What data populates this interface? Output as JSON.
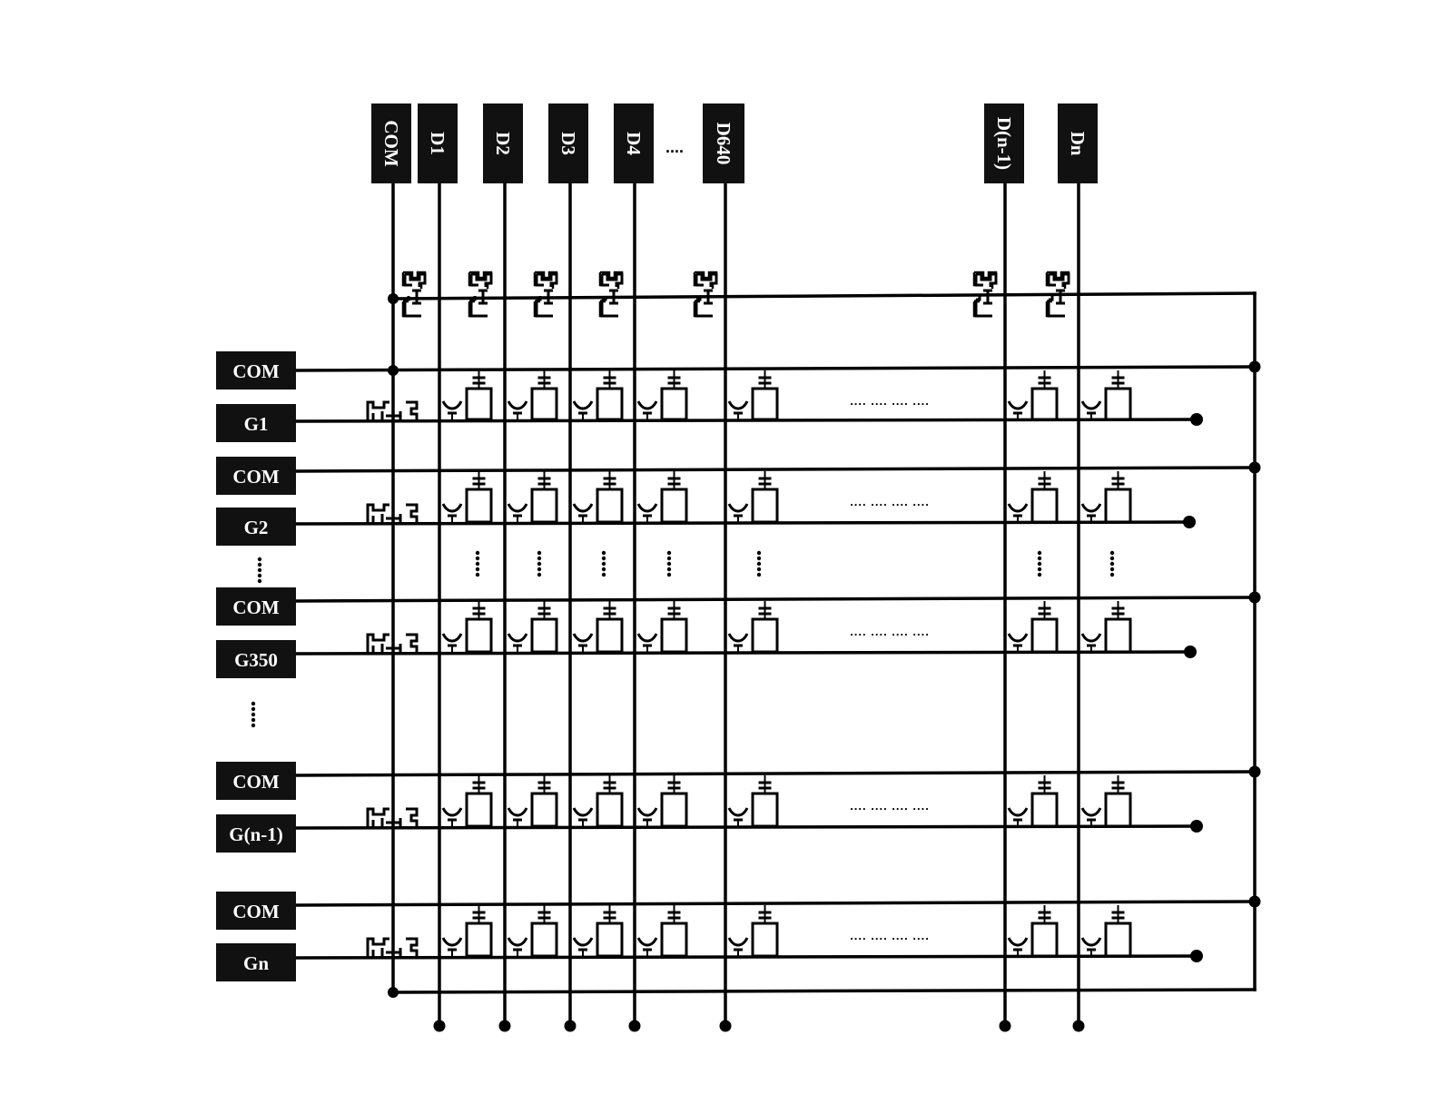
{
  "diagram": {
    "title": "",
    "type": "TFT-LCD array test circuit",
    "colors": {
      "line": "#000000",
      "label_bg": "#111111",
      "label_text": "#ffffff",
      "background": "#ffffff"
    }
  },
  "top_labels": [
    {
      "id": "com-top",
      "text": "COM"
    },
    {
      "id": "d1",
      "text": "D1"
    },
    {
      "id": "d2",
      "text": "D2"
    },
    {
      "id": "d3",
      "text": "D3"
    },
    {
      "id": "d4",
      "text": "D4"
    },
    {
      "id": "d640",
      "text": "D640"
    },
    {
      "id": "dn-1",
      "text": "D(n-1)"
    },
    {
      "id": "dn",
      "text": "Dn"
    }
  ],
  "top_ellipsis": "....",
  "left_labels": [
    {
      "id": "com-1",
      "text": "COM",
      "kind": "com"
    },
    {
      "id": "g1",
      "text": "G1",
      "kind": "gate"
    },
    {
      "id": "com-2",
      "text": "COM",
      "kind": "com"
    },
    {
      "id": "g2",
      "text": "G2",
      "kind": "gate"
    },
    {
      "id": "com-3",
      "text": "COM",
      "kind": "com"
    },
    {
      "id": "g350",
      "text": "G350",
      "kind": "gate"
    },
    {
      "id": "com-4",
      "text": "COM",
      "kind": "com"
    },
    {
      "id": "gn-1",
      "text": "G(n-1)",
      "kind": "gate"
    },
    {
      "id": "com-5",
      "text": "COM",
      "kind": "com"
    },
    {
      "id": "gn",
      "text": "Gn",
      "kind": "gate"
    }
  ],
  "row_ellipsis": ".... .... .... ....",
  "vertical_ellipsis": "⋮",
  "components": {
    "pixel_cell": "tft-storage-capacitor-pixel",
    "shorting_transistor": "protection-tft"
  }
}
